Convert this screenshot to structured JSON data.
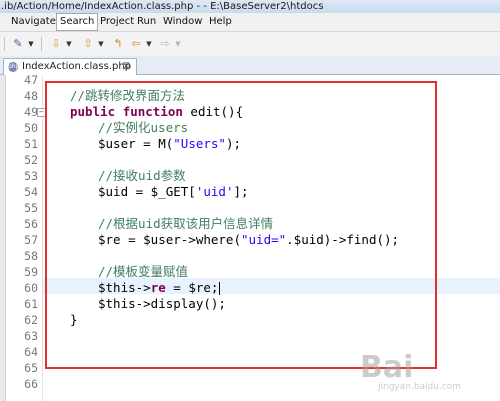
{
  "window": {
    "title": ".ib/Action/Home/IndexAction.class.php -  - E:\\BaseServer2\\htdocs"
  },
  "menubar": {
    "items": [
      "Navigate",
      "Search",
      "Project",
      "Run",
      "Window",
      "Help"
    ]
  },
  "toolbar": {
    "icons": [
      "wand-icon",
      "dropdown-arrow-icon",
      "next-annotation-icon",
      "dropdown-arrow-icon",
      "prev-annotation-icon",
      "dropdown-arrow-icon",
      "last-edit-icon",
      "back-icon",
      "dropdown-arrow-icon",
      "forward-icon",
      "dropdown-arrow-icon"
    ]
  },
  "editor": {
    "tab_label": "IndexAction.class.php",
    "tab_icon_text": "php",
    "tab_close": "⊠",
    "line_numbers": [
      "47",
      "48",
      "49",
      "50",
      "51",
      "52",
      "53",
      "54",
      "55",
      "56",
      "57",
      "58",
      "59",
      "60",
      "61",
      "62",
      "63",
      "64",
      "65",
      "66"
    ],
    "code": {
      "l48": "//跳转修改界面方法",
      "l49_kw1": "public",
      "l49_kw2": "function",
      "l49_rest": " edit(){",
      "l50": "//实例化users",
      "l51_pre": "$user = M(",
      "l51_str": "\"Users\"",
      "l51_post": ");",
      "l53": "//接收uid参数",
      "l54_pre": "$uid = $_GET[",
      "l54_str": "'uid'",
      "l54_post": "];",
      "l56": "//根据uid获取该用户信息详情",
      "l57_pre": "$re = $user->where(",
      "l57_str": "\"uid=\"",
      "l57_post": ".$uid)->find();",
      "l59": "//模板变量赋值",
      "l60_pre": "$this->",
      "l60_kw": "re",
      "l60_post": " = $re;",
      "l61": "$this->display();",
      "l62": "}"
    }
  },
  "watermark": {
    "logo": "Bai",
    "url": "jingyan.baidu.com"
  },
  "colors": {
    "highlight_box": "#e23030",
    "keyword": "#7f0055",
    "comment": "#3f7f5f",
    "string": "#2a00ff",
    "current_line": "#e8f2fe"
  }
}
